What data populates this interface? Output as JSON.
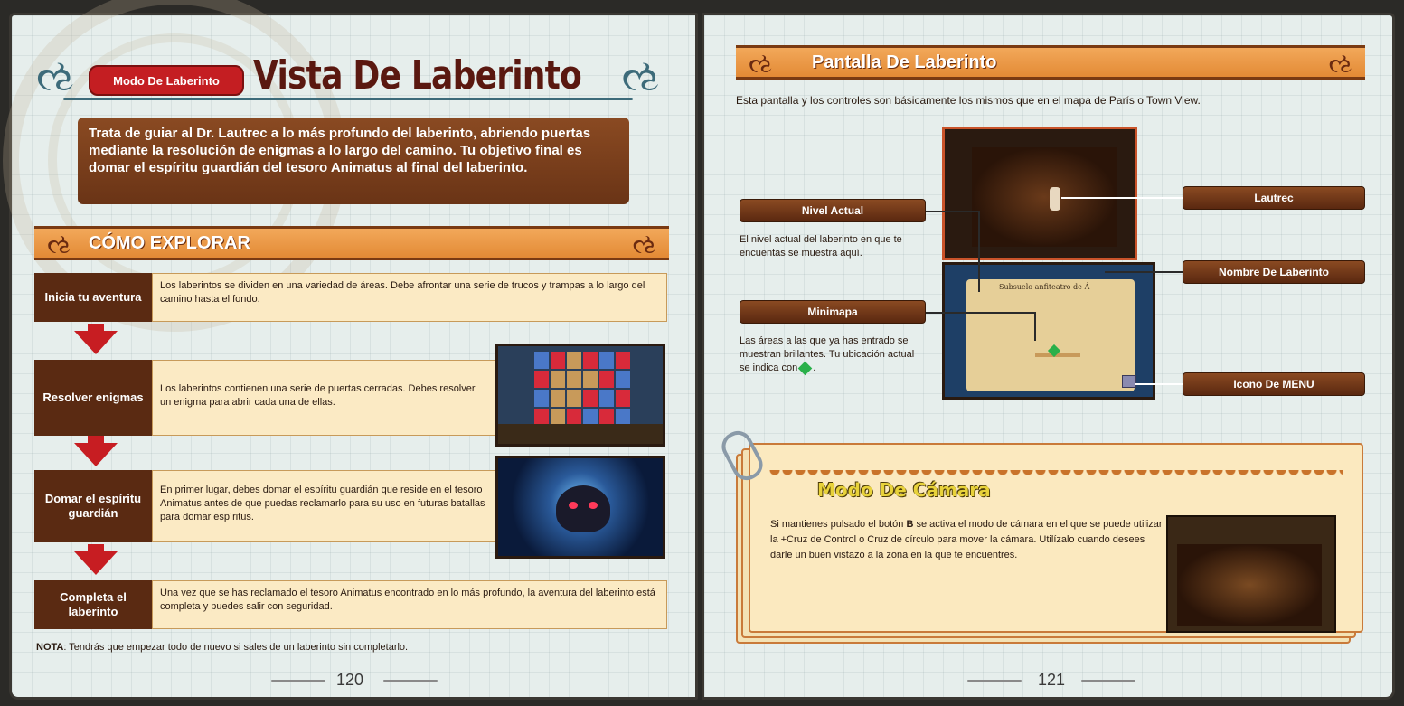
{
  "left_page": {
    "mode_badge": "Modo De Laberinto",
    "title": "Vista De Laberinto",
    "intro": "Trata de guiar al Dr. Lautrec a lo más profundo del laberinto, abriendo puertas mediante la resolución de enigmas a lo largo del camino. Tu objetivo final es domar el espíritu guardián del tesoro Animatus al final del laberinto.",
    "section_title": "CÓMO EXPLORAR",
    "steps": [
      {
        "label": "Inicia tu aventura",
        "text": "Los laberintos se dividen en una variedad de áreas. Debe afrontar  una serie de trucos y trampas a lo largo del camino hasta el fondo."
      },
      {
        "label": "Resolver enigmas",
        "text": "Los laberintos contienen una serie de puertas cerradas. Debes resolver un enigma para abrir cada una de ellas."
      },
      {
        "label": "Domar el espíritu guardián",
        "text": "En primer lugar, debes domar el espíritu guardián que reside en el tesoro Animatus antes de que puedas reclamarlo para su uso en futuras batallas para domar espíritus."
      },
      {
        "label": "Completa el laberinto",
        "text": "Una vez que se has reclamado el tesoro Animatus encontrado en lo más profundo, la aventura del laberinto está completa y puedes salir con seguridad."
      }
    ],
    "nota_label": "NOTA",
    "nota_text": ": Tendrás que empezar todo de nuevo si sales de un laberinto sin completarlo.",
    "page_number": "120"
  },
  "right_page": {
    "section_title": "Pantalla De Laberinto",
    "description": "Esta pantalla y los controles son básicamente los mismos que en el mapa de París o Town View.",
    "callouts": {
      "nivel_actual": "Nivel Actual",
      "nivel_actual_desc": "El nivel actual del laberinto en que te encuentas se muestra aquí.",
      "minimapa": "Minimapa",
      "minimapa_desc": "Las áreas a las que  ya has entrado se muestran brillantes. Tu ubicación actual se indica con",
      "lautrec": "Lautrec",
      "nombre_laberinto": "Nombre De Laberinto",
      "icono_menu": "Icono De MENU"
    },
    "map_label": "Subsuelo anfiteatro de Á",
    "camera": {
      "title": "Modo De Cámara",
      "text_1": "Si mantienes pulsado el botón ",
      "button": "B",
      "text_2": " se activa el modo de cámara en el que se puede utilizar la +Cruz de Control o Cruz de círculo para mover la cámara. Utilízalo cuando desees darle un buen vistazo a la zona en la que te encuentres."
    },
    "page_number": "121"
  },
  "colors": {
    "accent_red": "#c41e22",
    "brown": "#5a2a12",
    "orange_bar": "#e38a35",
    "paper": "#fbeac4"
  }
}
